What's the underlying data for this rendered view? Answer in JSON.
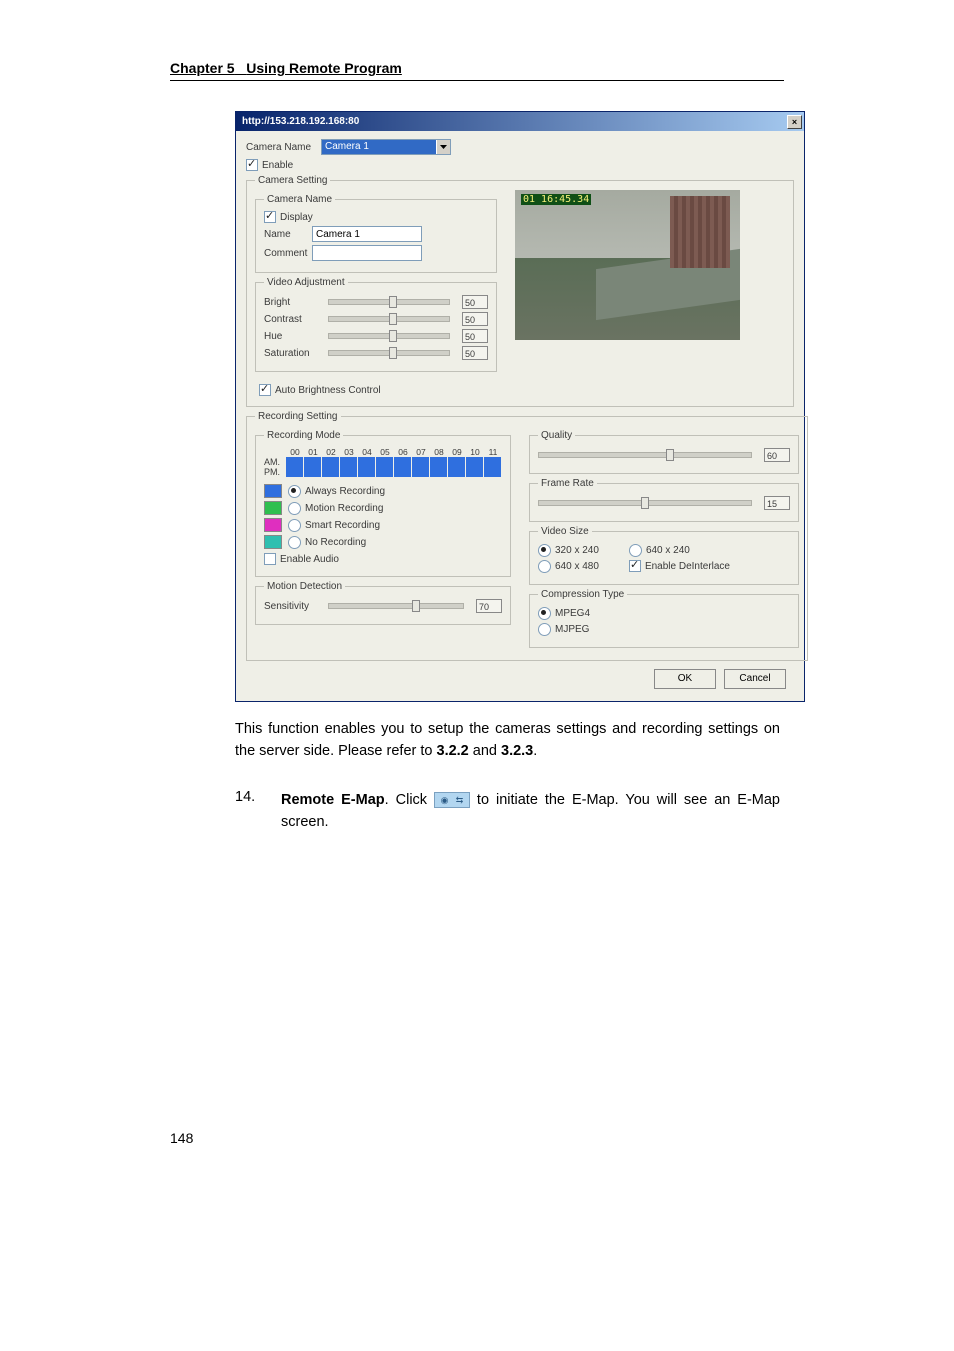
{
  "header": {
    "chapter": "Chapter 5",
    "title": "Using Remote Program"
  },
  "dialog": {
    "url": "http://153.218.192.168:80",
    "camera_name_label": "Camera Name",
    "camera_name_value": "Camera 1",
    "enable_label": "Enable",
    "enable_checked": true,
    "camera_setting_legend": "Camera Setting",
    "camera_name_inner_legend": "Camera Name",
    "display_label": "Display",
    "display_checked": true,
    "name_label": "Name",
    "name_value": "Camera 1",
    "comment_label": "Comment",
    "comment_value": "",
    "video_adjustment_legend": "Video Adjustment",
    "video_adjustment": {
      "bright_label": "Bright",
      "bright_value": "50",
      "contrast_label": "Contrast",
      "contrast_value": "50",
      "hue_label": "Hue",
      "hue_value": "50",
      "saturation_label": "Saturation",
      "saturation_value": "50"
    },
    "auto_brightness_label": "Auto Brightness Control",
    "auto_brightness_checked": true,
    "preview_timestamp": "01  16:45.34",
    "recording_setting_legend": "Recording Setting",
    "recording_mode_legend": "Recording Mode",
    "hours": [
      "00",
      "01",
      "02",
      "03",
      "04",
      "05",
      "06",
      "07",
      "08",
      "09",
      "10",
      "11"
    ],
    "am_label": "AM.",
    "pm_label": "PM.",
    "modes": {
      "always": "Always Recording",
      "motion": "Motion Recording",
      "smart": "Smart Recording",
      "none": "No Recording"
    },
    "selected_mode": "always",
    "enable_audio_label": "Enable Audio",
    "enable_audio_checked": false,
    "motion_detection_legend": "Motion Detection",
    "sensitivity_label": "Sensitivity",
    "sensitivity_value": "70",
    "quality_legend": "Quality",
    "quality_value": "60",
    "framerate_legend": "Frame Rate",
    "framerate_value": "15",
    "videosize_legend": "Video Size",
    "videosize_options": {
      "a": "320 x 240",
      "b": "640 x 240",
      "c": "640 x 480"
    },
    "videosize_selected": "a",
    "enable_deinterlace_label": "Enable DeInterlace",
    "enable_deinterlace_checked": true,
    "compression_legend": "Compression Type",
    "compression_options": {
      "mpeg4": "MPEG4",
      "mjpeg": "MJPEG"
    },
    "compression_selected": "mpeg4",
    "ok_label": "OK",
    "cancel_label": "Cancel"
  },
  "body_paragraph_a": "This function enables you to setup the cameras settings and recording settings on the server side. Please refer to ",
  "body_bold_1": "3.2.2",
  "body_paragraph_b": " and ",
  "body_bold_2": "3.2.3",
  "body_paragraph_c": ".",
  "item_num": "14.",
  "item_text_a": "Remote E-Map",
  "item_text_b": ". Click ",
  "item_text_c": " to initiate the E-Map. You will see an E-Map screen.",
  "pagenum": "148"
}
